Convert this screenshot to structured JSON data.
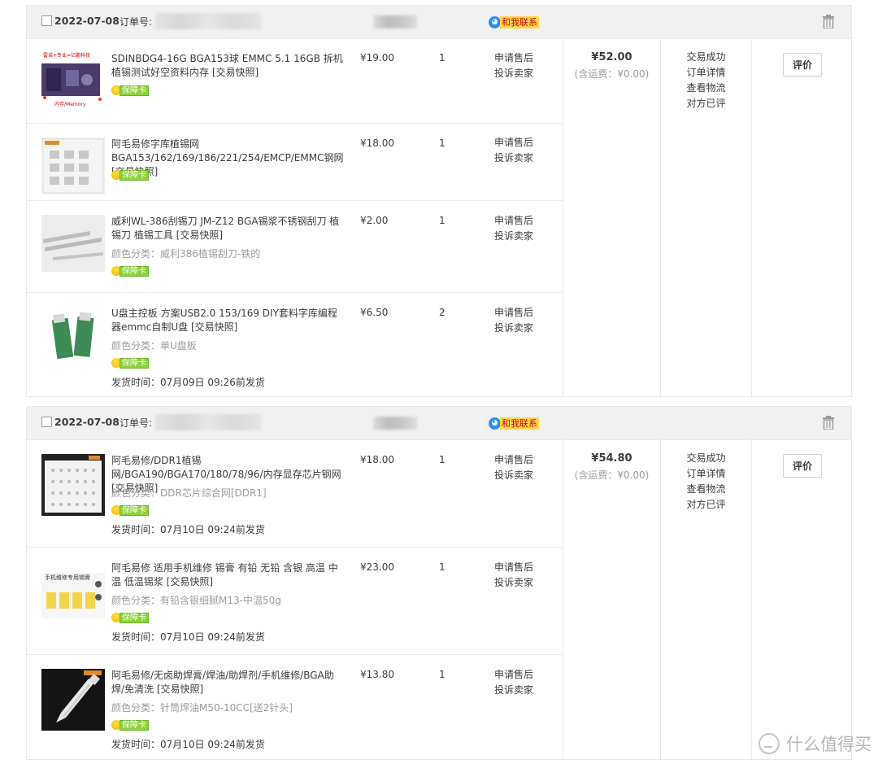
{
  "orders": [
    {
      "date": "2022-07-08",
      "order_label": "订单号:",
      "contact": "和我联系",
      "total": "¥52.00",
      "shipping": "(含运费：¥0.00)",
      "status": [
        "交易成功",
        "订单详情",
        "查看物流",
        "对方已评"
      ],
      "op": "评价",
      "items": [
        {
          "title": "SDINBDG4-16G BGA153球 EMMC 5.1 16GB 拆机植锡测试好空资料内存",
          "snapshot": "[交易快照]",
          "sku": "",
          "badge": "保障卡",
          "ship": "",
          "price": "¥19.00",
          "qty": "1",
          "actions": [
            "申请售后",
            "投诉卖家"
          ],
          "thumb_text": "雷诺+专业=亿鹏科技 内存/Memory"
        },
        {
          "title": "阿毛易修字库植锡网BGA153/162/169/186/221/254/EMCP/EMMC钢网",
          "snapshot": "[交易快照]",
          "sku": "",
          "badge": "保障卡",
          "ship": "",
          "price": "¥18.00",
          "qty": "1",
          "actions": [
            "申请售后",
            "投诉卖家"
          ],
          "thumb_text": ""
        },
        {
          "title": "威利WL-386刮锡刀 JM-Z12 BGA锡浆不锈钢刮刀 植锡刀 植锡工具",
          "snapshot": "[交易快照]",
          "sku": "颜色分类：威利386植锡刮刀-铁的",
          "badge": "保障卡",
          "ship": "",
          "price": "¥2.00",
          "qty": "1",
          "actions": [
            "申请售后",
            "投诉卖家"
          ],
          "thumb_text": ""
        },
        {
          "title": "U盘主控板 方案USB2.0 153/169 DIY套料字库编程器emmc自制U盘",
          "snapshot": "[交易快照]",
          "sku": "颜色分类：单U盘板",
          "badge": "保障卡",
          "ship": "发货时间：07月09日 09:26前发货",
          "price": "¥6.50",
          "qty": "2",
          "actions": [
            "申请售后",
            "投诉卖家"
          ],
          "thumb_text": ""
        }
      ]
    },
    {
      "date": "2022-07-08",
      "order_label": "订单号:",
      "contact": "和我联系",
      "total": "¥54.80",
      "shipping": "(含运费：¥0.00)",
      "status": [
        "交易成功",
        "订单详情",
        "查看物流",
        "对方已评"
      ],
      "op": "评价",
      "items": [
        {
          "title": "阿毛易修/DDR1植锡网/BGA190/BGA170/180/78/96/内存显存芯片钢网",
          "snapshot": "[交易快照]",
          "sku": "颜色分类：DDR芯片综合网[DDR1]",
          "badge": "保障卡",
          "ship": "发货时间：07月10日 09:24前发货",
          "price": "¥18.00",
          "qty": "1",
          "actions": [
            "申请售后",
            "投诉卖家"
          ],
          "thumb_text": ""
        },
        {
          "title": "阿毛易修 适用手机维修 锡膏 有铅 无铅 含银 高温 中温 低温锡浆",
          "snapshot": "[交易快照]",
          "sku": "颜色分类：有铅含银细腻M13-中温50g",
          "badge": "保障卡",
          "ship": "发货时间：07月10日 09:24前发货",
          "price": "¥23.00",
          "qty": "1",
          "actions": [
            "申请售后",
            "投诉卖家"
          ],
          "thumb_text": "手机维修专用锡膏"
        },
        {
          "title": "阿毛易修/无卤助焊膏/焊油/助焊剂/手机维修/BGA助焊/免清洗",
          "snapshot": "[交易快照]",
          "sku": "颜色分类：针筒焊油M50-10CC[送2针头]",
          "badge": "保障卡",
          "ship": "发货时间：07月10日 09:24前发货",
          "price": "¥13.80",
          "qty": "1",
          "actions": [
            "申请售后",
            "投诉卖家"
          ],
          "thumb_text": ""
        }
      ]
    }
  ],
  "watermark": "什么值得买",
  "colors": {
    "contact_bg": "#ffd84a",
    "contact_text": "#d3000a",
    "badge_green": "#8fd13a",
    "header_bg": "#f1f1f1"
  }
}
